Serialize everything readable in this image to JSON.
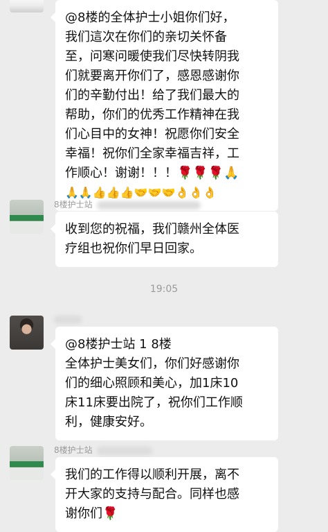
{
  "messages": [
    {
      "lines": [
        "@8楼的全体护士小姐你们好，",
        "我们這次在你们的亲切关怀备",
        "至，问寒问暖使我们尽快转阴我",
        "们就要离开你们了，感恩感谢你",
        "们的辛勤付出！给了我们最大的",
        "帮助，你们的优秀工作精神在我",
        "们心目中的女神！祝愿你们安全",
        "幸福！祝你们全家幸福吉祥，工",
        "作顺心！谢谢！！！🌹🌹🌹🙏",
        "🙏🙏👍👍👍🤝🤝🤝👌👌👌"
      ]
    },
    {
      "sender": "8楼护士站",
      "lines": [
        "收到您的祝福，我们赣州全体医",
        "疗组也祝你们早日回家。"
      ]
    },
    {
      "time": "19:05"
    },
    {
      "sender": "",
      "lines": [
        "@8楼护士站 1   8楼",
        "全体护士美女们，你们好感谢你",
        "们的细心照顾和美心，加1床10",
        "床11床要出院了，祝你们工作顺",
        "利，健康安好。"
      ]
    },
    {
      "sender": "8楼护士站",
      "lines": [
        "我们的工作得以顺利开展，离不",
        "开大家的支持与配合。同样也感",
        "谢你们🌹"
      ]
    }
  ]
}
